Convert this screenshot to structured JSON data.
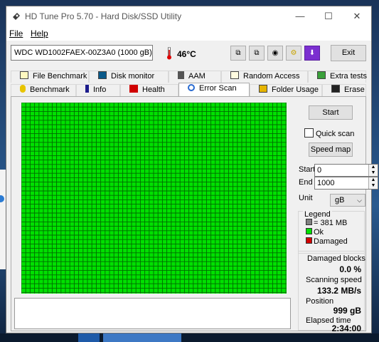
{
  "window": {
    "title": "HD Tune Pro 5.70 - Hard Disk/SSD Utility",
    "controls": {
      "minimize": "—",
      "maximize": "☐",
      "close": "✕"
    }
  },
  "menu": {
    "file": "File",
    "help": "Help"
  },
  "toolbar": {
    "drive": "WDC WD1002FAEX-00Z3A0 (1000 gB)",
    "temperature": "46°C",
    "exit_label": "Exit",
    "buttons": [
      "copy-info-icon",
      "copy-icon",
      "camera-icon",
      "settings-icon",
      "download-icon"
    ]
  },
  "tabs_top": [
    {
      "label": "File Benchmark",
      "icon": "file-benchmark-icon"
    },
    {
      "label": "Disk monitor",
      "icon": "disk-monitor-icon"
    },
    {
      "label": "AAM",
      "icon": "speaker-icon"
    },
    {
      "label": "Random Access",
      "icon": "random-access-icon"
    },
    {
      "label": "Extra tests",
      "icon": "extra-tests-icon"
    }
  ],
  "tabs_bottom": [
    {
      "label": "Benchmark",
      "icon": "benchmark-icon"
    },
    {
      "label": "Info",
      "icon": "info-icon"
    },
    {
      "label": "Health",
      "icon": "health-icon"
    },
    {
      "label": "Error Scan",
      "icon": "search-icon"
    },
    {
      "label": "Folder Usage",
      "icon": "folder-icon"
    },
    {
      "label": "Erase",
      "icon": "erase-icon"
    }
  ],
  "scan": {
    "block_status": "all-ok",
    "colors": {
      "ok": "#00e000",
      "damaged": "#d40000",
      "grid": "#006b00",
      "empty": "#808080"
    }
  },
  "controls": {
    "start_label": "Start",
    "quick_scan_label": "Quick scan",
    "quick_scan_checked": false,
    "speed_map_label": "Speed map",
    "start_field_label": "Start",
    "start_value": "0",
    "end_field_label": "End",
    "end_value": "1000",
    "unit_label": "Unit",
    "unit_value": "gB"
  },
  "legend": {
    "title": "Legend",
    "block_size": "= 381 MB",
    "ok": "Ok",
    "damaged": "Damaged"
  },
  "stats": {
    "damaged_blocks_label": "Damaged blocks",
    "damaged_blocks_value": "0.0 %",
    "scanning_speed_label": "Scanning speed",
    "scanning_speed_value": "133.2 MB/s",
    "position_label": "Position",
    "position_value": "999 gB",
    "elapsed_label": "Elapsed time",
    "elapsed_value": "2:34:00"
  }
}
